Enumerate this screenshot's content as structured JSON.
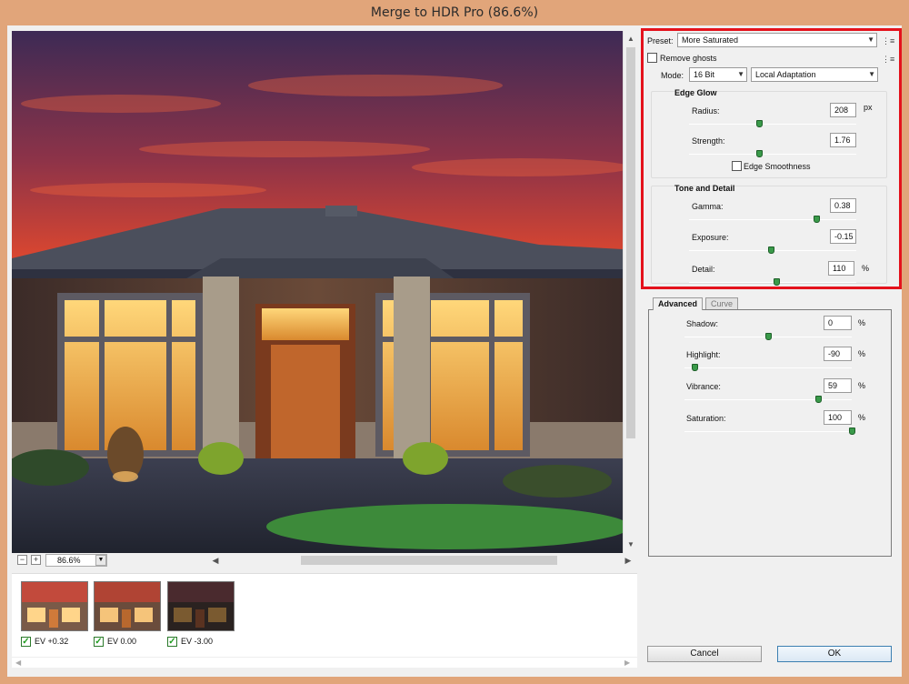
{
  "window": {
    "title": "Merge to HDR Pro (86.6%)"
  },
  "zoom": {
    "value": "86.6%",
    "minus": "−",
    "plus": "+"
  },
  "thumbnails": [
    {
      "label": "EV +0.32",
      "checked": true
    },
    {
      "label": "EV 0.00",
      "checked": true
    },
    {
      "label": "EV -3.00",
      "checked": true
    }
  ],
  "settings": {
    "preset_label": "Preset:",
    "preset_value": "More Saturated",
    "remove_ghosts_label": "Remove ghosts",
    "mode_label": "Mode:",
    "mode_bits": "16 Bit",
    "mode_method": "Local Adaptation",
    "edge_glow": {
      "title": "Edge Glow",
      "radius_label": "Radius:",
      "radius_value": "208",
      "radius_unit": "px",
      "strength_label": "Strength:",
      "strength_value": "1.76",
      "edge_smoothness_label": "Edge Smoothness"
    },
    "tone_detail": {
      "title": "Tone and Detail",
      "gamma_label": "Gamma:",
      "gamma_value": "0.38",
      "exposure_label": "Exposure:",
      "exposure_value": "-0.15",
      "detail_label": "Detail:",
      "detail_value": "110",
      "detail_unit": "%"
    }
  },
  "advanced": {
    "tab_advanced": "Advanced",
    "tab_curve": "Curve",
    "shadow_label": "Shadow:",
    "shadow_value": "0",
    "highlight_label": "Highlight:",
    "highlight_value": "-90",
    "vibrance_label": "Vibrance:",
    "vibrance_value": "59",
    "saturation_label": "Saturation:",
    "saturation_value": "100",
    "percent": "%"
  },
  "buttons": {
    "cancel": "Cancel",
    "ok": "OK"
  },
  "colors": {
    "highlight_box": "#e4121c",
    "window_frame": "#e1a57a",
    "slider_knob": "#3a9a4a"
  }
}
